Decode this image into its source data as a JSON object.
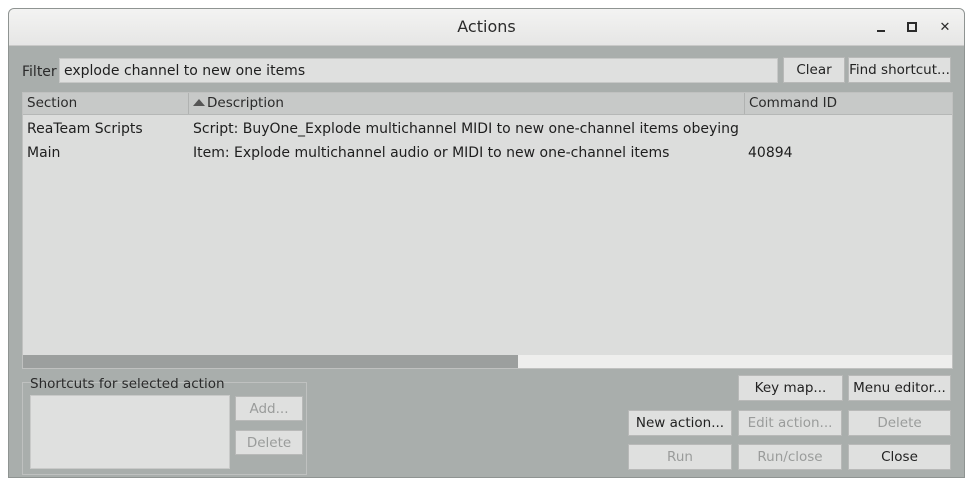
{
  "window": {
    "title": "Actions"
  },
  "titlebar_buttons": {
    "close_glyph": "✕"
  },
  "filter": {
    "label": "Filter",
    "value": "explode channel to new one items"
  },
  "buttons": {
    "clear": "Clear",
    "find_shortcut": "Find shortcut...",
    "add": "Add...",
    "delete_shortcut": "Delete",
    "key_map": "Key map...",
    "menu_editor": "Menu editor...",
    "new_action": "New action...",
    "edit_action": "Edit action...",
    "delete_action": "Delete",
    "run": "Run",
    "run_close": "Run/close",
    "close": "Close"
  },
  "table": {
    "columns": {
      "section": "Section",
      "description": "Description",
      "command_id": "Command ID"
    },
    "sort_column": "description",
    "rows": [
      {
        "section": "ReaTeam Scripts",
        "description": "Script: BuyOne_Explode multichannel MIDI to new one-channel items obeying key...",
        "command_id": ""
      },
      {
        "section": "Main",
        "description": "Item: Explode multichannel audio or MIDI to new one-channel items",
        "command_id": "40894"
      }
    ]
  },
  "shortcuts": {
    "label": "Shortcuts for selected action"
  },
  "colors": {
    "window_bg": "#a9aeac",
    "list_bg": "#dcdddc",
    "button_bg": "#dfe0df"
  }
}
